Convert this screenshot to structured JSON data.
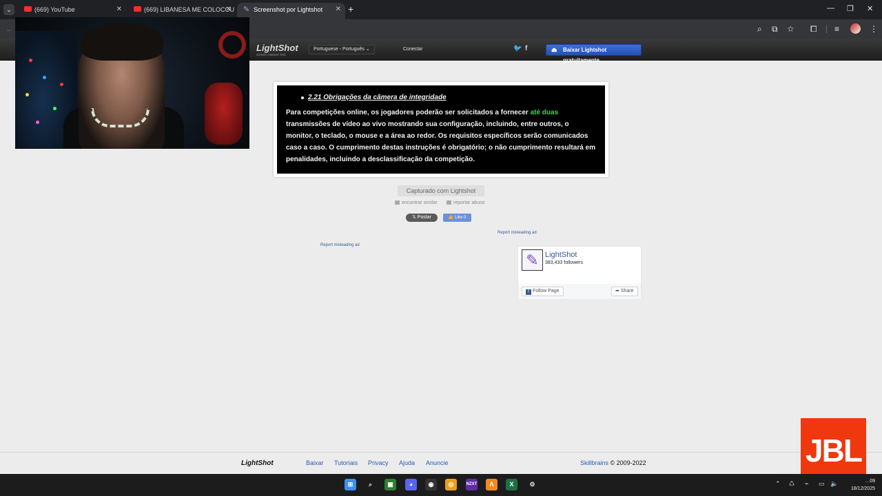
{
  "browser": {
    "tabs": [
      {
        "title": "(669) YouTube",
        "icon": "youtube-icon"
      },
      {
        "title": "(669) LIBANESA ME COLOCOU",
        "icon": "youtube-icon"
      },
      {
        "title": "Screenshot por Lightshot",
        "icon": "lightshot-pen-icon",
        "active": true
      }
    ],
    "colors": {
      "tabstrip": "#202124",
      "toolbar": "#35363a"
    }
  },
  "lightshot": {
    "logo": "LightShot",
    "logo_sub": "screen capture tool",
    "language": "Portuguese - Português",
    "connect": "Conectar",
    "download": "Baixar Lightshot gratuitamente",
    "screenshot": {
      "heading": "2.21 Obrigações da câmera de integridade",
      "para_before": "Para competições online, os jogadores poderão ser solicitados a fornecer ",
      "para_green": "até duas",
      "para_after": " transmissões de vídeo ao vivo mostrando sua configuração, incluindo, entre outros, o monitor, o teclado, o mouse e a área ao redor. Os requisitos específicos serão comunicados caso a caso. O cumprimento destas instruções é obrigatório; o não cumprimento resultará em penalidades, incluindo a desclassificação da competição.",
      "green_color": "#3cd84a"
    },
    "captured": "Capturado com Lightshot",
    "similar": "encontrar similar",
    "report": "reportar abuso",
    "post": "Postar",
    "like": "Like 0",
    "ad_report_left": "Report misleading ad",
    "ad_report_right": "Report misleading ad",
    "fb": {
      "name": "LightShot",
      "followers": "383,433 followers",
      "follow": "Follow Page",
      "share": "Share"
    },
    "footer": {
      "logo": "LightShot",
      "links": [
        "Baixar",
        "Tutoriais",
        "Privacy",
        "Ajuda",
        "Anuncie"
      ],
      "company": "Skillbrains",
      "copyright": " © 2009-2022"
    }
  },
  "overlay": {
    "jbl": "JBL"
  },
  "taskbar": {
    "time": "…09",
    "date": "18/12/2025",
    "apps": [
      "start-icon",
      "search-icon",
      "nvidia-icon",
      "discord-icon",
      "obs-icon",
      "chrome-icon",
      "nzxt-icon",
      "app-a-icon",
      "excel-icon",
      "settings-icon"
    ],
    "nzxt_label": "NZXT"
  }
}
